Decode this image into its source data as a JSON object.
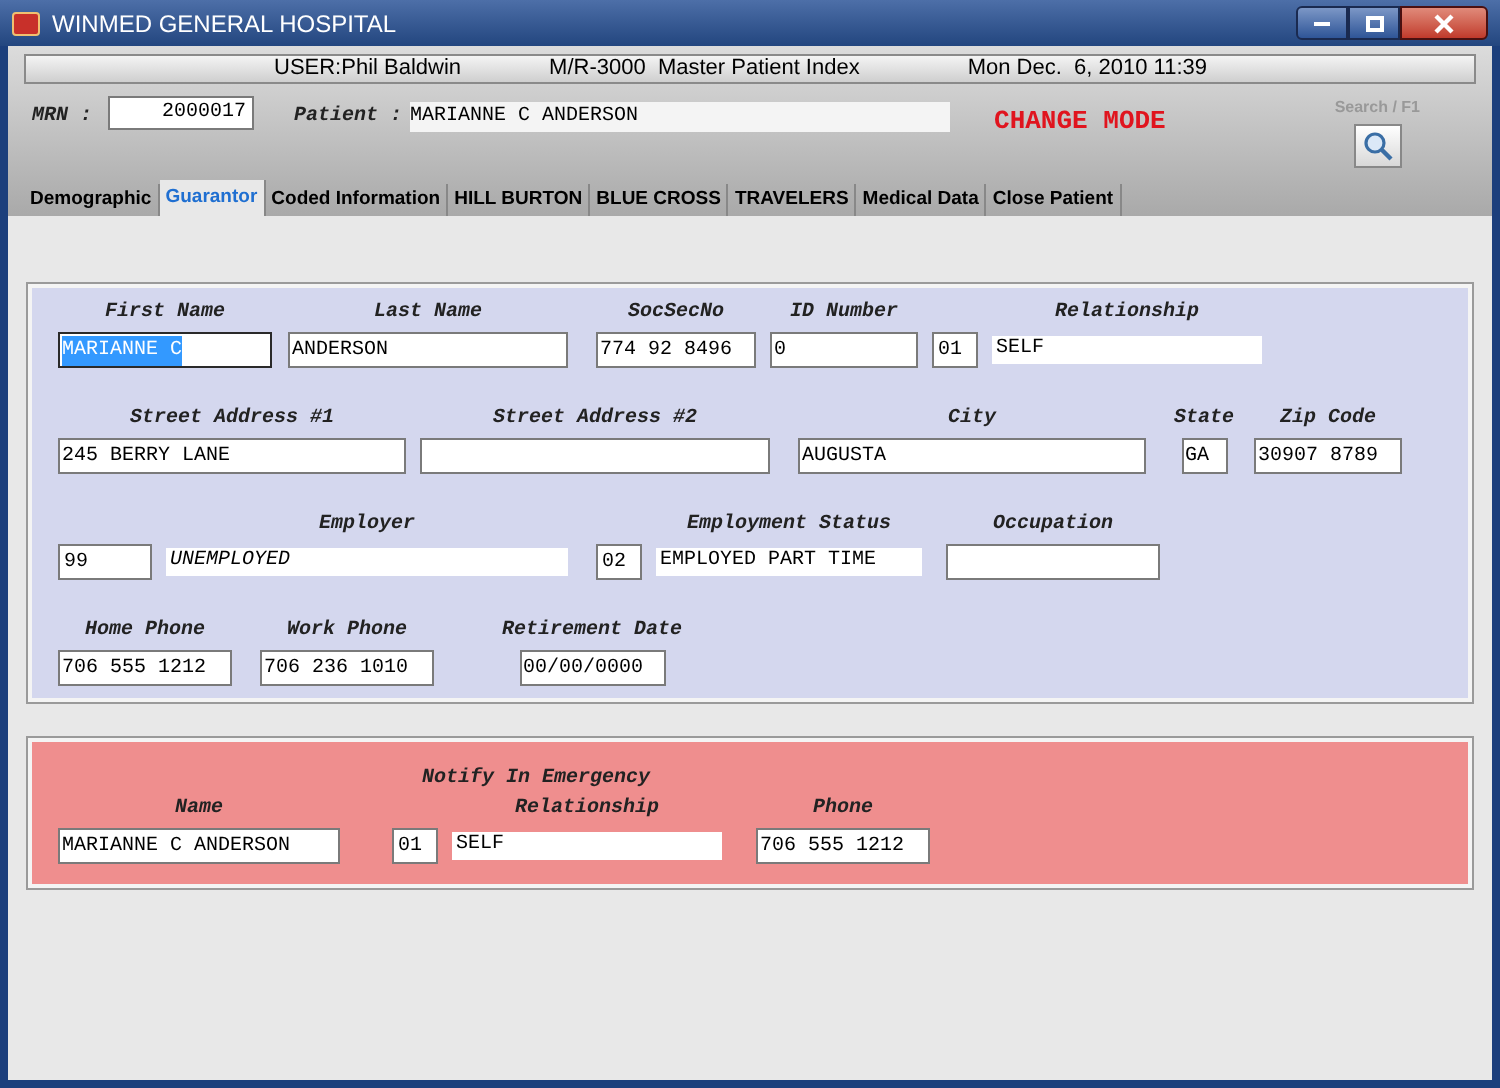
{
  "window": {
    "title": "WINMED GENERAL HOSPITAL"
  },
  "header": {
    "user": "USER:Phil Baldwin",
    "module": "M/R-3000  Master Patient Index",
    "datetime": "Mon Dec.  6, 2010 11:39"
  },
  "patient_bar": {
    "mrn_label": "MRN :",
    "mrn": "2000017",
    "patient_label": "Patient :",
    "patient": "MARIANNE C ANDERSON",
    "mode": "CHANGE MODE",
    "search_label": "Search / F1"
  },
  "tabs": [
    {
      "label": "Demographic",
      "selected": false
    },
    {
      "label": "Guarantor",
      "selected": true
    },
    {
      "label": "Coded Information",
      "selected": false
    },
    {
      "label": "HILL BURTON",
      "selected": false
    },
    {
      "label": "BLUE CROSS",
      "selected": false
    },
    {
      "label": "TRAVELERS",
      "selected": false
    },
    {
      "label": "Medical Data",
      "selected": false
    },
    {
      "label": "Close Patient",
      "selected": false
    }
  ],
  "guarantor_rows": [
    [
      {
        "kind": "text",
        "label": "First Name",
        "value": "MARIANNE C",
        "selected": true
      },
      {
        "kind": "text",
        "label": "Last Name",
        "value": "ANDERSON",
        "selected": false
      },
      {
        "kind": "text",
        "label": "SocSecNo",
        "value": "774 92 8496",
        "selected": false
      },
      {
        "kind": "text",
        "label": "ID Number",
        "value": "0",
        "selected": false
      },
      {
        "kind": "coded",
        "label": "Relationship",
        "code": "01",
        "value": "SELF"
      }
    ],
    [
      {
        "kind": "text",
        "label": "Street Address #1",
        "value": "245 BERRY LANE",
        "selected": false
      },
      {
        "kind": "text",
        "label": "Street Address #2",
        "selected": false
      },
      {
        "kind": "text",
        "label": "City",
        "value": "AUGUSTA",
        "selected": false
      },
      {
        "kind": "text",
        "label": "State",
        "value": "GA",
        "selected": false
      },
      {
        "kind": "text",
        "label": "Zip Code",
        "value": "30907 8789",
        "selected": false
      }
    ],
    [
      {
        "kind": "coded",
        "label": "Employer",
        "code": "99",
        "value": "UNEMPLOYED",
        "italic": true
      },
      {
        "kind": "coded",
        "label": "Employment Status",
        "code": "02",
        "value": "EMPLOYED PART TIME"
      },
      {
        "kind": "text",
        "label": "Occupation",
        "selected": false
      }
    ],
    [
      {
        "kind": "text",
        "label": "Home Phone",
        "value": "706 555 1212",
        "selected": false
      },
      {
        "kind": "text",
        "label": "Work Phone",
        "value": "706 236 1010",
        "selected": false
      },
      {
        "kind": "text",
        "label": "Retirement Date",
        "value": "00/00/0000",
        "selected": false
      }
    ]
  ],
  "emergency": {
    "title": "Notify In Emergency",
    "fields": [
      {
        "kind": "text",
        "label": "Name",
        "value": "MARIANNE C ANDERSON",
        "selected": false
      },
      {
        "kind": "coded",
        "label": "Relationship",
        "code": "01",
        "value": "SELF"
      },
      {
        "kind": "text",
        "label": "Phone",
        "value": "706 555 1212",
        "selected": false
      }
    ]
  }
}
